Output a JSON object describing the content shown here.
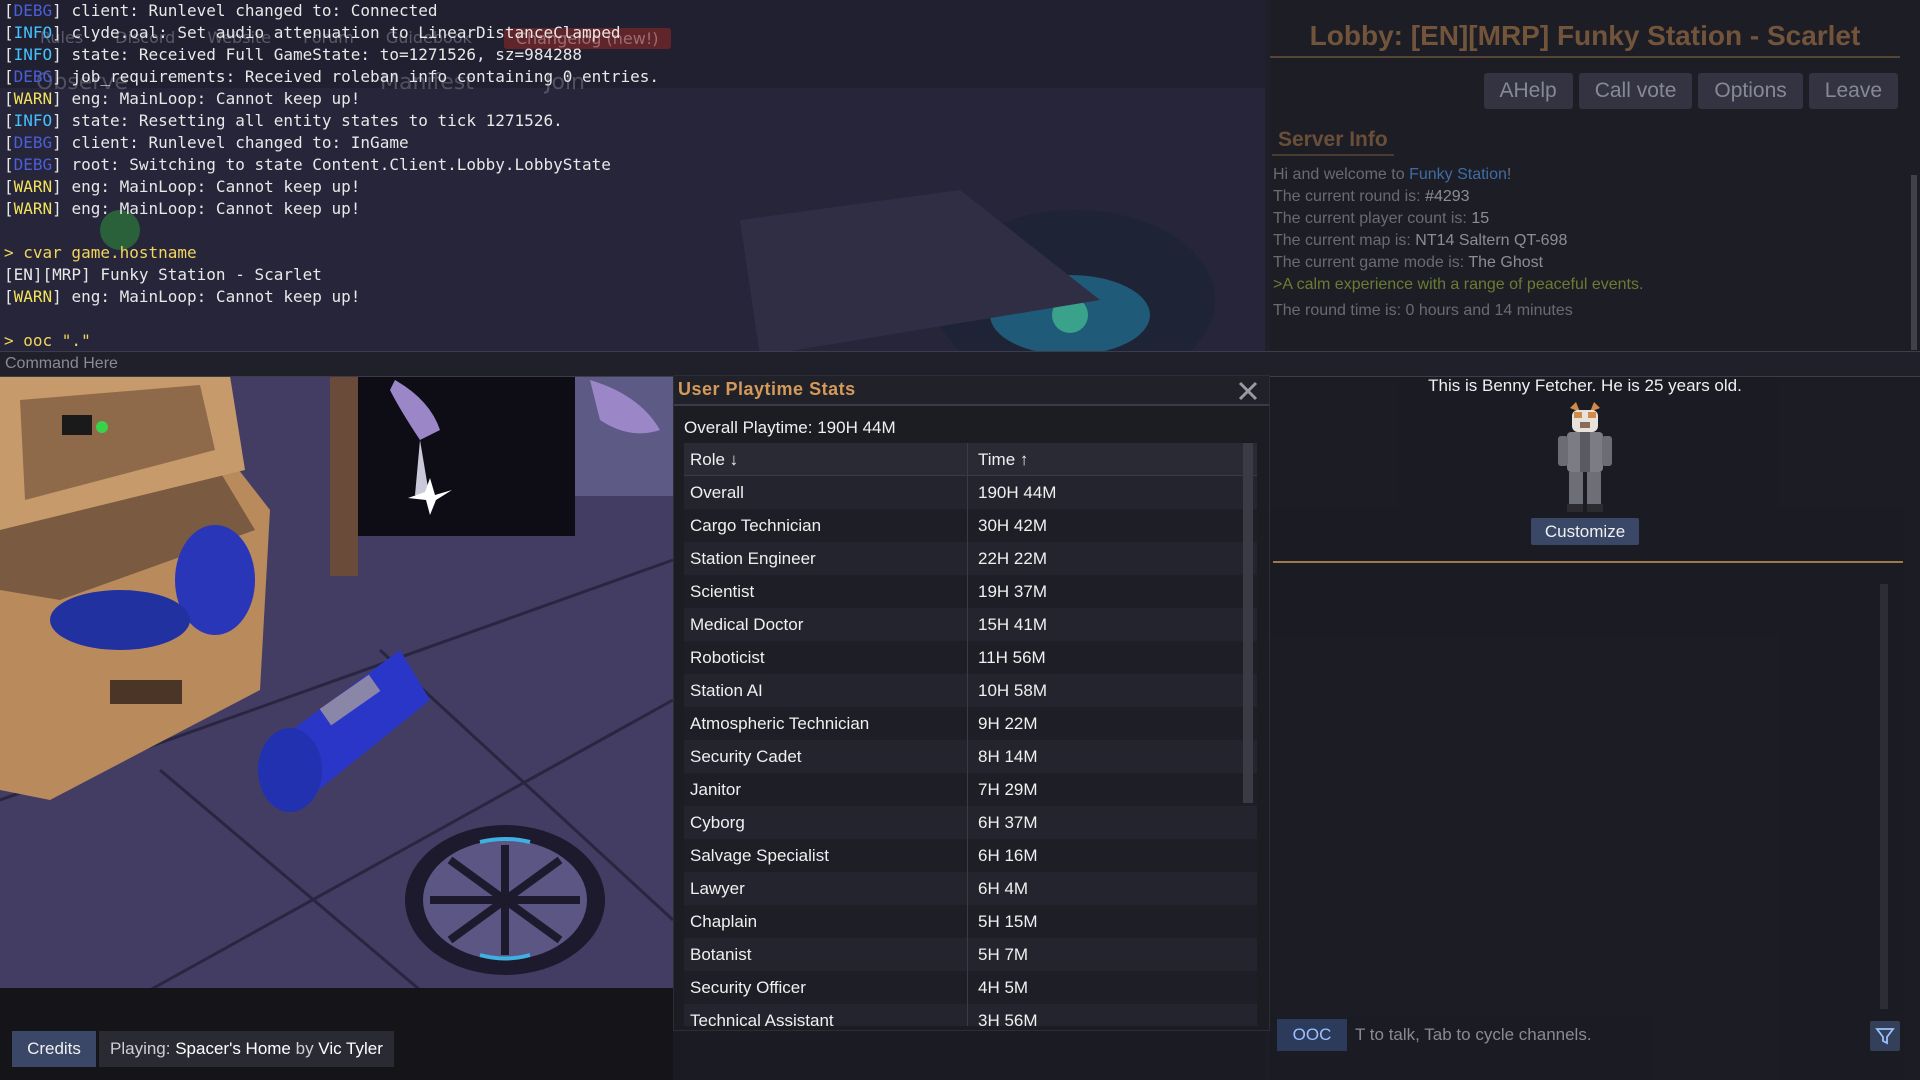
{
  "lobby": {
    "title": "Lobby: [EN][MRP] Funky Station - Scarlet",
    "links": [
      "Rules",
      "Discord",
      "Website",
      "Forum",
      "Guidebook",
      "Changelog (new!)"
    ],
    "observe": "Observe",
    "manifest": "Manifest",
    "join": "Join",
    "buttons": {
      "ahelp": "AHelp",
      "callvote": "Call vote",
      "options": "Options",
      "leave": "Leave"
    },
    "server_info_title": "Server Info",
    "server_info": {
      "welcome_pre": "Hi and welcome to ",
      "station_link": "Funky Station",
      "welcome_post": "!",
      "round_label": "The current round is: ",
      "round_value": "#4293",
      "players_label": "The current player count is: ",
      "players_value": "15",
      "map_label": "The current map is: ",
      "map_value": "NT14 Saltern QT-698",
      "mode_label": "The current game mode is: ",
      "mode_value": "The Ghost",
      "flavor": ">A calm experience with a range of peaceful events.",
      "round_time": "The round time is: 0 hours and 14 minutes"
    },
    "character_description": "This is Benny Fetcher. He is 25 years old.",
    "customize": "Customize"
  },
  "console": {
    "lines": [
      {
        "tag": "DEBG",
        "kind": "debg",
        "text": "client: Runlevel changed to: Connected"
      },
      {
        "tag": "INFO",
        "kind": "info",
        "text": "clyde.oal: Set audio attenuation to LinearDistanceClamped"
      },
      {
        "tag": "INFO",
        "kind": "info",
        "text": "state: Received Full GameState: to=1271526, sz=984288"
      },
      {
        "tag": "DEBG",
        "kind": "debg",
        "text": "job_requirements: Received roleban info containing 0 entries."
      },
      {
        "tag": "WARN",
        "kind": "warn",
        "text": "eng: MainLoop: Cannot keep up!"
      },
      {
        "tag": "INFO",
        "kind": "info",
        "text": "state: Resetting all entity states to tick 1271526."
      },
      {
        "tag": "DEBG",
        "kind": "debg",
        "text": "client: Runlevel changed to: InGame"
      },
      {
        "tag": "DEBG",
        "kind": "debg",
        "text": "root: Switching to state Content.Client.Lobby.LobbyState"
      },
      {
        "tag": "WARN",
        "kind": "warn",
        "text": "eng: MainLoop: Cannot keep up!"
      },
      {
        "tag": "WARN",
        "kind": "warn",
        "text": "eng: MainLoop: Cannot keep up!"
      },
      {
        "tag": "",
        "kind": "blank",
        "text": ""
      },
      {
        "tag": "",
        "kind": "cmd",
        "text": "> cvar game.hostname"
      },
      {
        "tag": "",
        "kind": "plain",
        "text": "[EN][MRP] Funky Station - Scarlet"
      },
      {
        "tag": "WARN",
        "kind": "warn",
        "text": "eng: MainLoop: Cannot keep up!"
      },
      {
        "tag": "",
        "kind": "blank",
        "text": ""
      },
      {
        "tag": "",
        "kind": "cmd",
        "text": "> ooc \".\""
      }
    ],
    "input_placeholder": "Command Here"
  },
  "stats": {
    "title": "User Playtime Stats",
    "overall_label": "Overall Playtime: ",
    "overall_value": "190H 44M",
    "col_role": "Role ↓",
    "col_time": "Time ↑",
    "rows": [
      {
        "role": "Overall",
        "time": "190H 44M"
      },
      {
        "role": "Cargo Technician",
        "time": "30H 42M"
      },
      {
        "role": "Station Engineer",
        "time": "22H 22M"
      },
      {
        "role": "Scientist",
        "time": "19H 37M"
      },
      {
        "role": "Medical Doctor",
        "time": "15H 41M"
      },
      {
        "role": "Roboticist",
        "time": "11H 56M"
      },
      {
        "role": "Station AI",
        "time": "10H 58M"
      },
      {
        "role": "Atmospheric Technician",
        "time": "9H 22M"
      },
      {
        "role": "Security Cadet",
        "time": "8H 14M"
      },
      {
        "role": "Janitor",
        "time": "7H 29M"
      },
      {
        "role": "Cyborg",
        "time": "6H 37M"
      },
      {
        "role": "Salvage Specialist",
        "time": "6H 16M"
      },
      {
        "role": "Lawyer",
        "time": "6H 4M"
      },
      {
        "role": "Chaplain",
        "time": "5H 15M"
      },
      {
        "role": "Botanist",
        "time": "5H 7M"
      },
      {
        "role": "Security Officer",
        "time": "4H 5M"
      },
      {
        "role": "Technical Assistant",
        "time": "3H 56M"
      }
    ]
  },
  "chat": {
    "channel": "OOC",
    "hint": "T to talk, Tab to cycle channels."
  },
  "bottom": {
    "credits": "Credits",
    "playing_label": "Playing: ",
    "song": "Spacer's Home",
    "by": " by ",
    "artist": "Vic Tyler"
  },
  "icons": {
    "close": "close-icon",
    "filter": "filter-icon"
  }
}
